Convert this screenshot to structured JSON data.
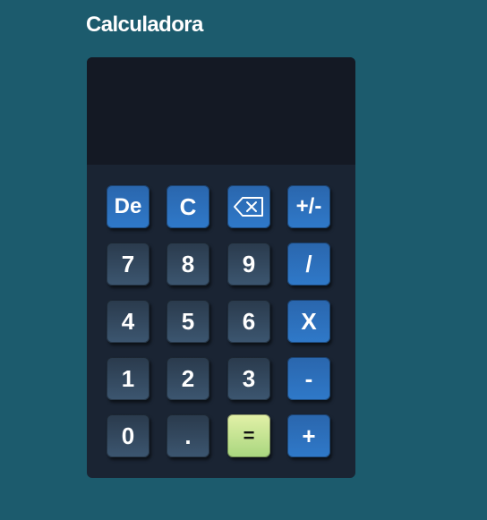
{
  "app": {
    "title": "Calculadora"
  },
  "display": {
    "value": ""
  },
  "keys": {
    "delete": "De",
    "clear": "C",
    "backspace_icon": "backspace-icon",
    "plus_minus": "+/-",
    "seven": "7",
    "eight": "8",
    "nine": "9",
    "divide": "/",
    "four": "4",
    "five": "5",
    "six": "6",
    "multiply": "X",
    "one": "1",
    "two": "2",
    "three": "3",
    "minus": "-",
    "zero": "0",
    "dot": ".",
    "equals": "=",
    "plus": "+"
  },
  "colors": {
    "page_background": "#1c5b6d",
    "calculator_body": "#1a2433",
    "display_background": "#141924",
    "operator_key": "#2f79c9",
    "number_key": "#3c5670",
    "equals_key": "#c6e39a"
  }
}
